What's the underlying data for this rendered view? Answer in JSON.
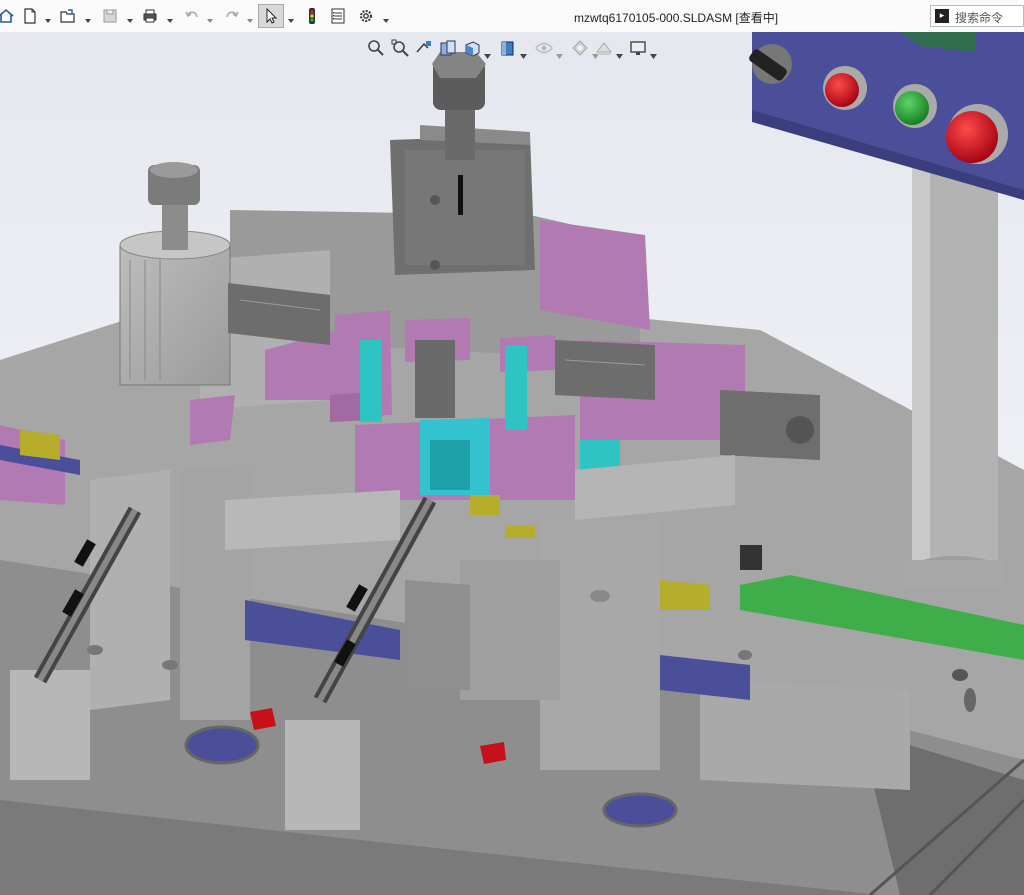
{
  "app": {
    "document_title": "mzwtq6170105-000.SLDASM [查看中]"
  },
  "search": {
    "placeholder": "搜索命令",
    "icon": "command-prompt-icon"
  },
  "toolbar": {
    "buttons": [
      {
        "icon": "home-icon"
      },
      {
        "icon": "new-document-icon"
      },
      {
        "icon": "open-folder-icon"
      },
      {
        "icon": "save-icon"
      },
      {
        "icon": "print-icon"
      },
      {
        "icon": "undo-icon"
      },
      {
        "icon": "redo-icon"
      },
      {
        "icon": "select-pointer-icon",
        "selected": true
      },
      {
        "icon": "rebuild-traffic-light-icon"
      },
      {
        "icon": "file-properties-icon"
      },
      {
        "icon": "options-gear-icon"
      }
    ]
  },
  "view_toolbar": {
    "buttons": [
      {
        "icon": "zoom-to-fit-icon"
      },
      {
        "icon": "zoom-to-area-icon"
      },
      {
        "icon": "previous-view-icon"
      },
      {
        "icon": "section-view-icon"
      },
      {
        "icon": "view-orientation-icon"
      },
      {
        "icon": "display-style-icon"
      },
      {
        "icon": "hide-show-items-icon"
      },
      {
        "icon": "edit-appearance-icon"
      },
      {
        "icon": "apply-scene-icon"
      },
      {
        "icon": "view-settings-icon"
      }
    ]
  },
  "colors": {
    "steel_gray": "#a9a9a9",
    "dark_gray": "#6f6f6f",
    "purple_plate": "#b27ab2",
    "cyan_part": "#2ec4c4",
    "navy_panel": "#4b4f9a",
    "green_strip": "#3fae4a",
    "button_red": "#c8101a",
    "button_green": "#1f9a2a",
    "olive_part": "#b7ad2c",
    "sky_bg_top": "#e6e9f0"
  }
}
